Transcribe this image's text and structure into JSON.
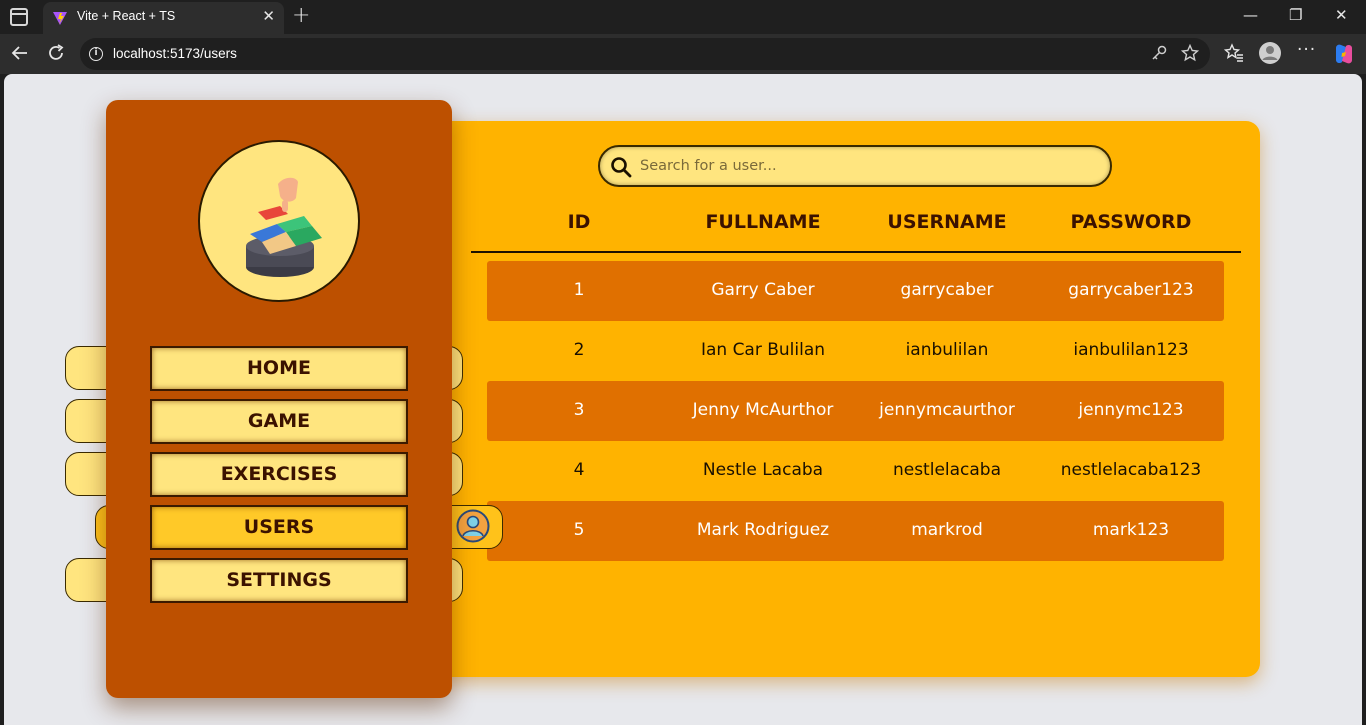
{
  "browser": {
    "tab_title": "Vite + React + TS",
    "tab_close": "✕",
    "new_tab": "+",
    "url": "localhost:5173/users",
    "win_min": "—",
    "win_max": "❐",
    "win_close": "✕"
  },
  "icons": {
    "back": "arrow-left-icon",
    "reload": "reload-icon",
    "info": "info-icon",
    "key": "key-icon",
    "star": "star-icon",
    "favorites": "favorites-icon",
    "profile": "profile-icon",
    "more": "more-icon",
    "copilot": "copilot-icon"
  },
  "colors": {
    "panel": "#ffb300",
    "sidebar": "#bd5000",
    "row_alt": "#e07000",
    "button": "#ffe57f",
    "button_active": "#ffc928",
    "heading_text": "#3b1200"
  },
  "search": {
    "placeholder": "Search for a user..."
  },
  "table": {
    "headers": [
      "ID",
      "FULLNAME",
      "USERNAME",
      "PASSWORD"
    ],
    "rows": [
      {
        "id": "1",
        "fullname": "Garry Caber",
        "username": "garrycaber",
        "password": "garrycaber123"
      },
      {
        "id": "2",
        "fullname": "Ian Car Bulilan",
        "username": "ianbulilan",
        "password": "ianbulilan123"
      },
      {
        "id": "3",
        "fullname": "Jenny McAurthor",
        "username": "jennymcaurthor",
        "password": "jennymc123"
      },
      {
        "id": "4",
        "fullname": "Nestle Lacaba",
        "username": "nestlelacaba",
        "password": "nestlelacaba123"
      },
      {
        "id": "5",
        "fullname": "Mark Rodriguez",
        "username": "markrod",
        "password": "mark123"
      }
    ]
  },
  "nav": {
    "items": [
      {
        "label": "HOME"
      },
      {
        "label": "GAME"
      },
      {
        "label": "EXERCISES"
      },
      {
        "label": "USERS",
        "active": true
      },
      {
        "label": "SETTINGS"
      }
    ]
  }
}
